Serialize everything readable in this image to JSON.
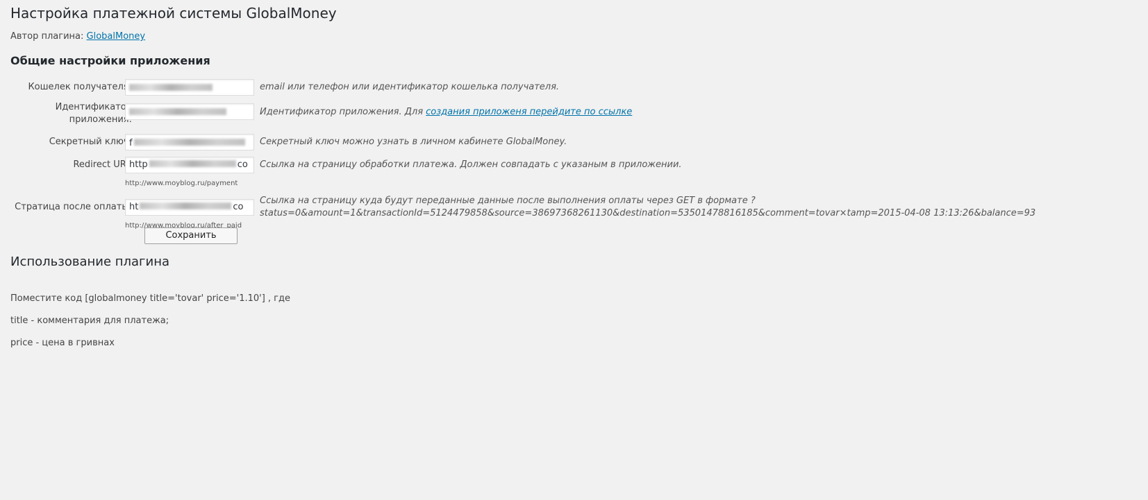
{
  "page_title": "Настройка платежной системы GlobalMoney",
  "author": {
    "label": "Автор плагина:",
    "link_text": "GlobalMoney"
  },
  "section_title": "Общие настройки приложения",
  "fields": {
    "wallet": {
      "label": "Кошелек получателя:",
      "description": "email или телефон или идентификатор кошелька получателя."
    },
    "app_id": {
      "label_line1": "Идентификатор",
      "label_line2": "приложения:",
      "description_prefix": "Идентификатор приложения. Для",
      "description_link": "создания приложеня перейдите по ссылке"
    },
    "secret": {
      "label": "Секретный ключ:",
      "value_visible": "f",
      "description": "Секретный ключ можно узнать в личном кабинете GlobalMoney."
    },
    "redirect": {
      "label": "Redirect URI:",
      "value_prefix": "http",
      "value_suffix": "co",
      "description": "Ссылка на страницу обработки платежа. Должен совпадать с указаным в приложении.",
      "hint": "http://www.moyblog.ru/payment"
    },
    "after_paid": {
      "label": "Стратица после оплаты:",
      "value_prefix": "ht",
      "value_suffix": "co",
      "description_line1": "Ссылка на страницу куда будут переданные данные после выполнения оплаты через GET в формате ?",
      "description_line2": "status=0&amount=1&transactionId=5124479858&source=38697368261130&destination=53501478816185&comment=tovar×tamp=2015-04-08 13:13:26&balance=93",
      "hint": "http://www.moyblog.ru/after_paid"
    }
  },
  "save_button": "Сохранить",
  "usage": {
    "title": "Использование плагина",
    "line1": "Поместите код [globalmoney title='tovar' price='1.10'] , где",
    "line2": "title - комментария для платежа;",
    "line3": "price - цена в гривнах"
  }
}
